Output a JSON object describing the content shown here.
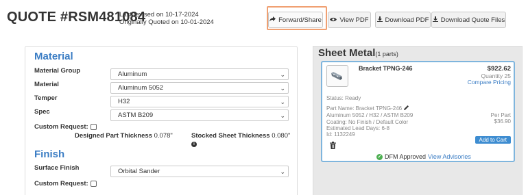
{
  "header": {
    "quote_title": "QUOTE #RSM481084",
    "last_revised": "Last revised on 10-17-2024",
    "originally_quoted": "Originally Quoted on 10-01-2024"
  },
  "toolbar": {
    "forward_label": "Forward/Share",
    "view_pdf_label": "View PDF",
    "download_pdf_label": "Download PDF",
    "download_files_label": "Download Quote Files"
  },
  "material": {
    "title": "Material",
    "fields": [
      {
        "label": "Material Group",
        "value": "Aluminum"
      },
      {
        "label": "Material",
        "value": "Aluminum 5052"
      },
      {
        "label": "Temper",
        "value": "H32"
      },
      {
        "label": "Spec",
        "value": "ASTM B209"
      }
    ],
    "custom_request_label": "Custom Request:",
    "designed_thickness_label": "Designed Part Thickness",
    "designed_thickness_value": "0.078\"",
    "stocked_thickness_label": "Stocked Sheet Thickness",
    "stocked_thickness_value": "0.080\""
  },
  "finish": {
    "title": "Finish",
    "surface_finish_label": "Surface Finish",
    "surface_finish_value": "Orbital Sander",
    "custom_request_label": "Custom Request:"
  },
  "sheet_metal": {
    "title": "Sheet Metal",
    "count": "(1 parts)",
    "part": {
      "name": "Bracket TPNG-246",
      "total_price": "$922.62",
      "quantity": "Quantity 25",
      "compare_label": "Compare Pricing",
      "status": "Status:  Ready",
      "part_name": "Part Name:  Bracket TPNG-246",
      "material_line": "Aluminum 5052 / H32 / ASTM B209",
      "coating_line": "Coating: No Finish / Default Color",
      "lead_days": "Estimated Lead Days: 6-8",
      "id_line": "Id: 1132249",
      "per_part_label": "Per Part",
      "per_part_price": "$36.90",
      "add_to_cart_label": "Add to Cart",
      "dfm_status": "DFM Approved",
      "advisories_label": "View Advisories"
    }
  }
}
